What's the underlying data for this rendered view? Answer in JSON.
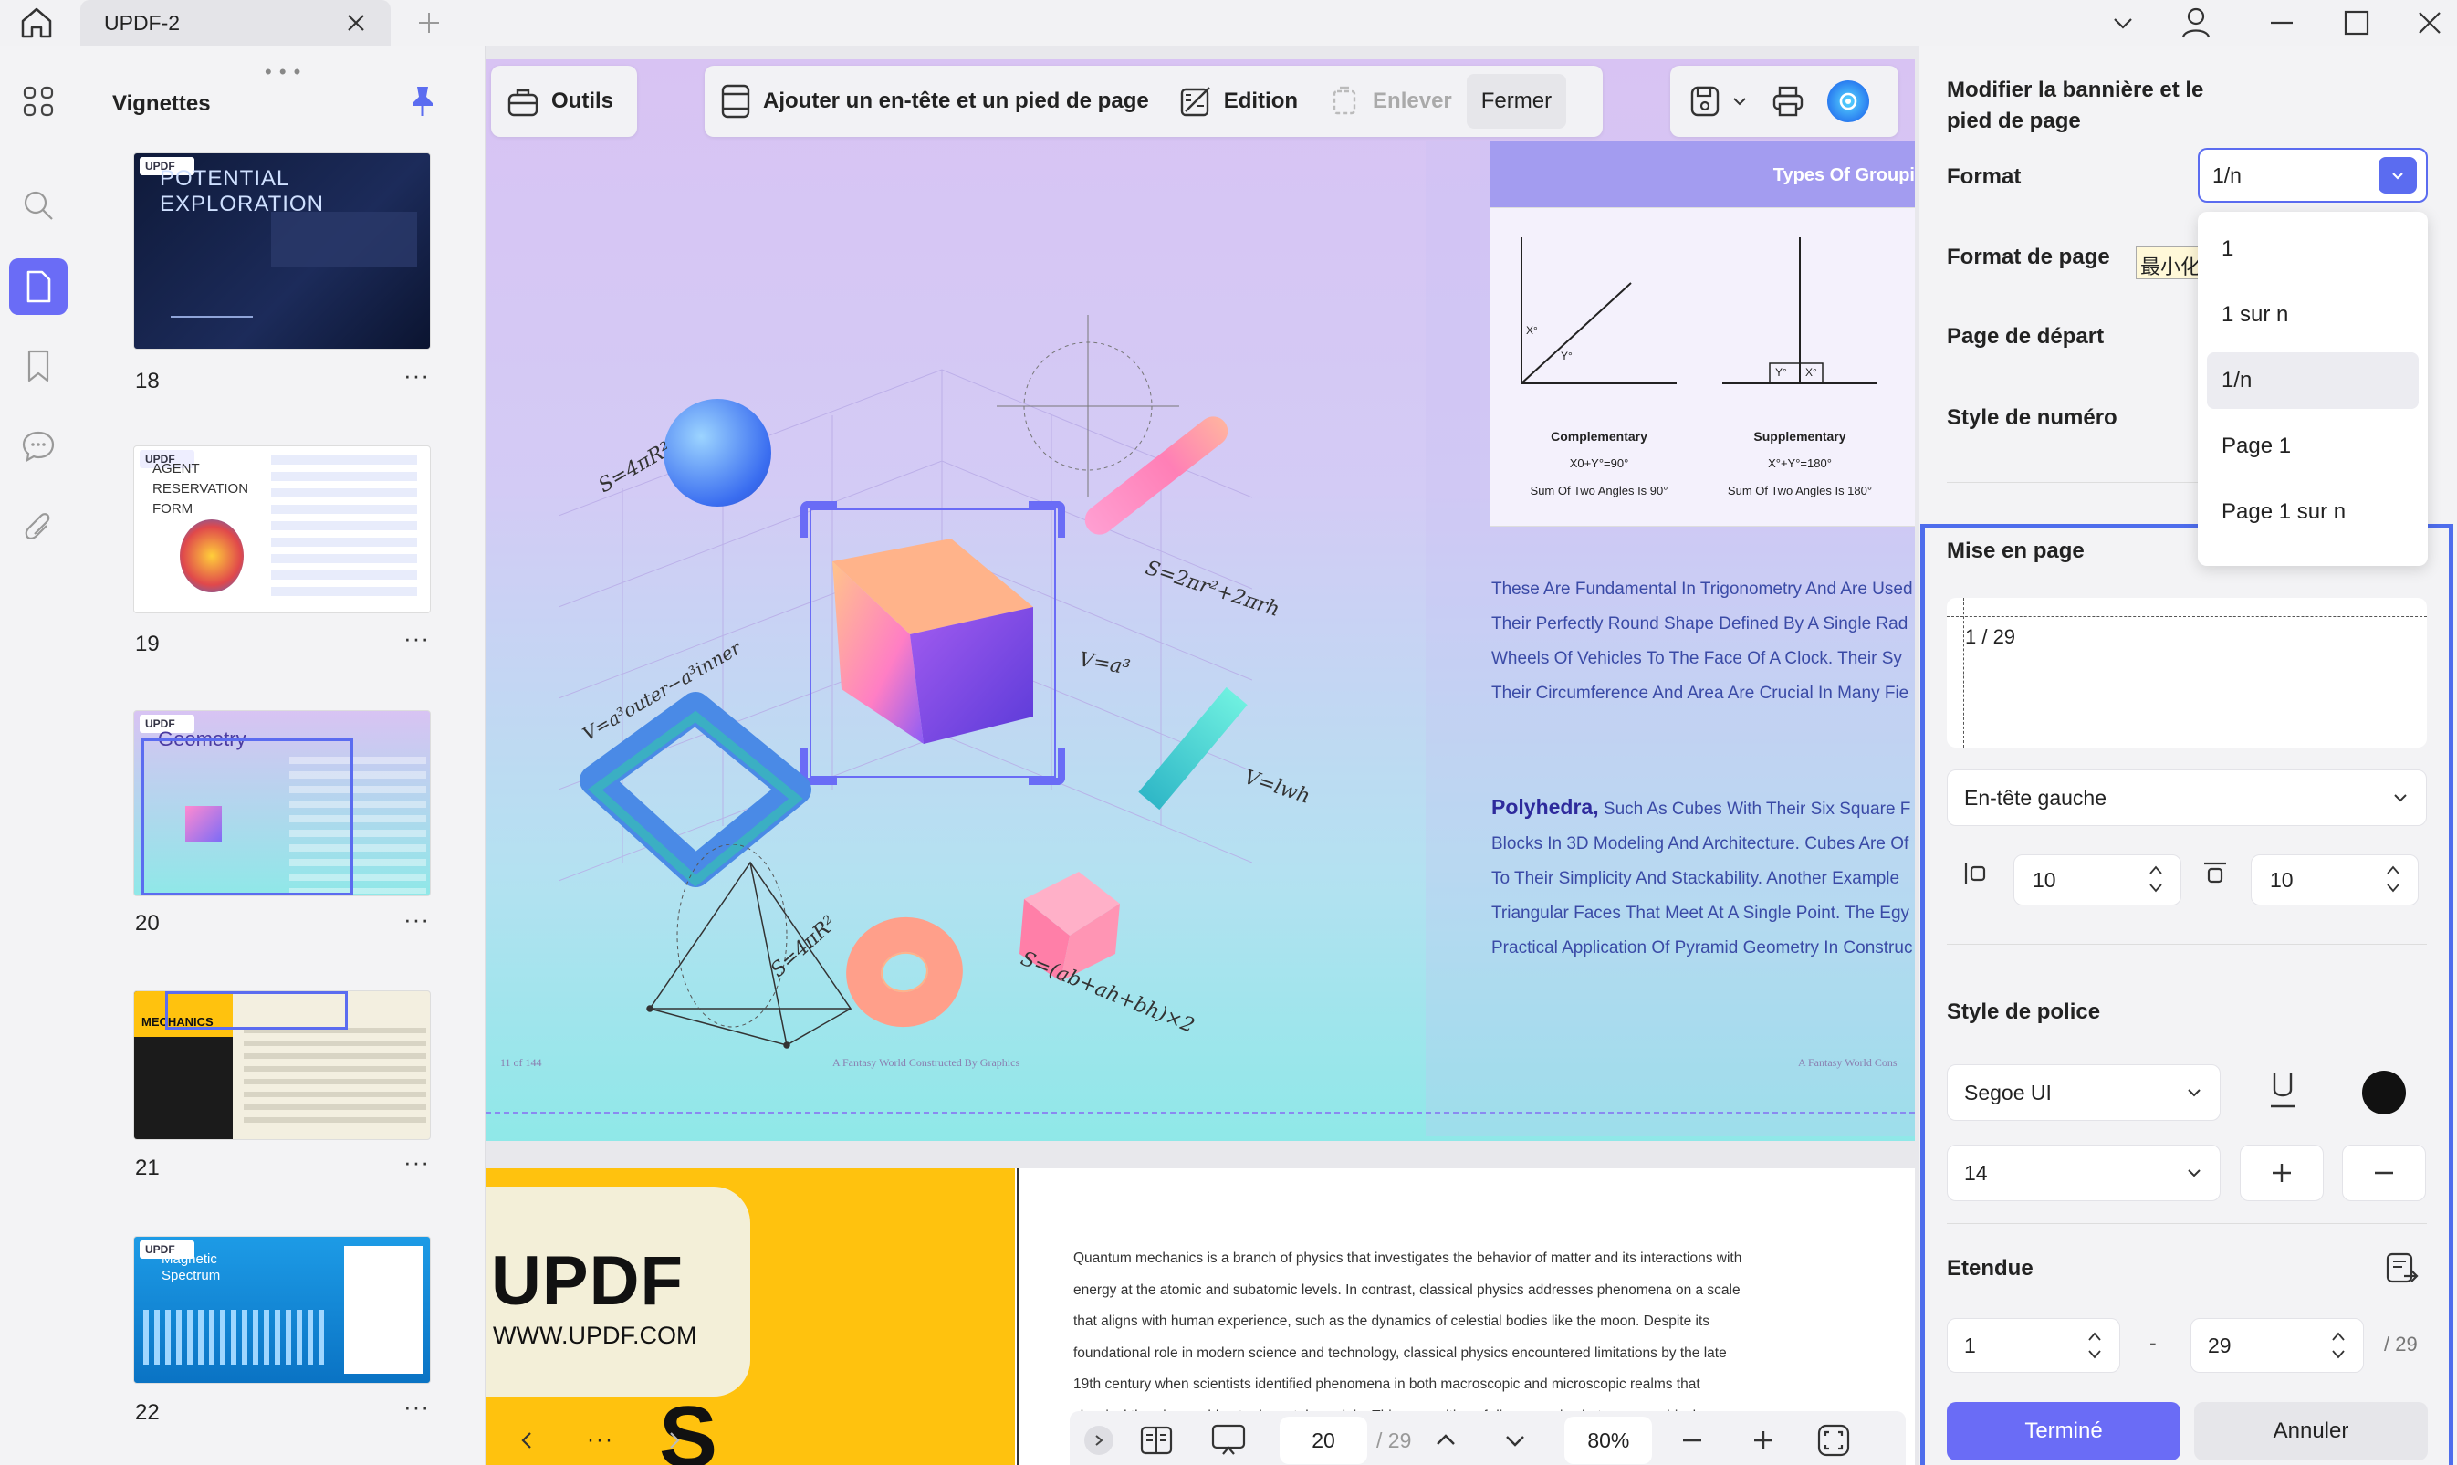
{
  "app": {
    "tab_title": "UPDF-2"
  },
  "thumbnails": {
    "title": "Vignettes",
    "items": [
      {
        "page": "18",
        "caption": "POTENTIAL EXPLORATION"
      },
      {
        "page": "19",
        "caption": "AGENT RESERVATION FORM"
      },
      {
        "page": "20",
        "caption": "Geometry"
      },
      {
        "page": "21",
        "caption": "MECHANICS"
      },
      {
        "page": "22",
        "caption": "Magnetic Spectrum"
      }
    ]
  },
  "toolbar": {
    "outils": "Outils",
    "header_footer": "Ajouter un en-tête et un pied de page",
    "edition": "Edition",
    "enlever": "Enlever",
    "fermer": "Fermer"
  },
  "page1": {
    "banner": "Types Of Groupi",
    "diagram1": {
      "title": "Complementary",
      "eq": "X0+Y°=90°",
      "desc": "Sum Of Two Angles Is 90°",
      "x_label": "X°",
      "y_label": "Y°"
    },
    "diagram2": {
      "title": "Supplementary",
      "eq": "X°+Y°=180°",
      "desc": "Sum Of Two Angles Is 180°",
      "y_label": "Y°",
      "x_label": "X°"
    },
    "para1": [
      "These Are Fundamental In Trigonometry And Are Used",
      "Their Perfectly Round Shape Defined By A Single Rad",
      "Wheels Of Vehicles To The Face Of A Clock. Their Sy",
      "Their Circumference And Area Are Crucial In Many Fie"
    ],
    "para2_head": "Polyhedra,",
    "para2": [
      "Such As Cubes With Their Six Square F",
      "Blocks In 3D Modeling And Architecture. Cubes Are Of",
      "To Their Simplicity And Stackability. Another Example",
      "Triangular Faces That Meet At A Single Point. The Egy",
      "Practical Application Of Pyramid Geometry In Construc"
    ],
    "formulas": {
      "f1": "S=4πR²",
      "f2": "S=2πr²+2πrh",
      "f3": "V=a³",
      "f4": "V=a³outer−a³inner",
      "f5": "V=lwh",
      "f6": "S=4πR²",
      "f7": "S=(ab+ah+bh)×2"
    },
    "footer_left": "11 of 144",
    "footer_mid": "A Fantasy World Constructed By Graphics",
    "footer_right": "A Fantasy World Cons"
  },
  "page2": {
    "logo": "UPDF",
    "url": "WWW.UPDF.COM",
    "big_letters": "S",
    "lines": [
      "Quantum mechanics is a branch of physics that investigates the behavior of matter and its interactions with",
      "energy at the atomic and subatomic levels. In contrast, classical physics addresses phenomena on a scale",
      "that aligns with human experience, such as the dynamics of celestial bodies like the moon. Despite its",
      "foundational role in modern science and technology, classical physics encountered limitations by the late",
      "19th century when scientists identified phenomena in both macroscopic and microscopic realms that",
      "classical theories could not adequately explain. This recognition of discrepancies between empirical"
    ]
  },
  "bottom_nav": {
    "current_page": "20",
    "total_pages": "/ 29",
    "zoom": "80%"
  },
  "panel": {
    "title": "Modifier la bannière et le pied de page",
    "format_label": "Format",
    "format_value": "1/n",
    "format_options": [
      "1",
      "1 sur n",
      "1/n",
      "Page 1",
      "Page 1 sur n"
    ],
    "selected_option": "1/n",
    "page_format_label": "Format de page",
    "page_format_value": "最小化",
    "start_page_label": "Page de départ",
    "number_style_label": "Style de numéro",
    "layout_label": "Mise en page",
    "preview_text": "1 / 29",
    "position_value": "En-tête gauche",
    "margin_left": "10",
    "margin_top": "10",
    "font_style_label": "Style de police",
    "font_value": "Segoe UI",
    "font_color": "#111111",
    "size_value": "14",
    "range_label": "Etendue",
    "range_from": "1",
    "range_to": "29",
    "range_total": "/ 29",
    "done": "Terminé",
    "cancel": "Annuler"
  },
  "colors": {
    "accent": "#6a6cf6",
    "frame": "#4e6dec"
  }
}
